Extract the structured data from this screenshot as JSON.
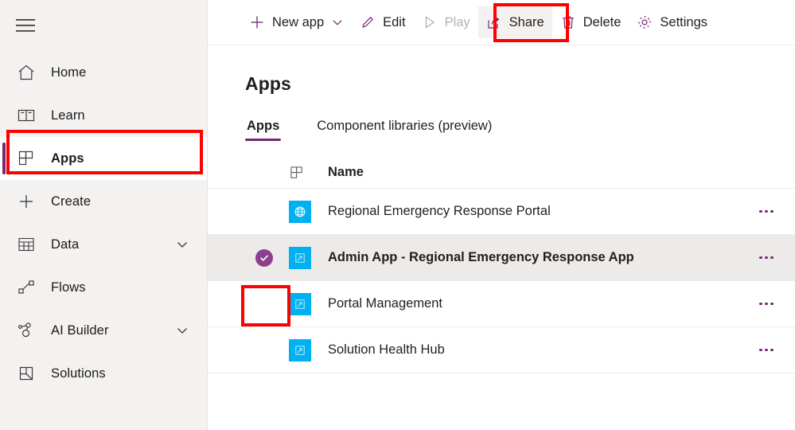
{
  "sidebar": {
    "menu_icon": "hamburger-icon",
    "items": [
      {
        "label": "Home",
        "icon": "home-icon",
        "selected": false,
        "chevron": false
      },
      {
        "label": "Learn",
        "icon": "book-icon",
        "selected": false,
        "chevron": false
      },
      {
        "label": "Apps",
        "icon": "apps-grid-icon",
        "selected": true,
        "chevron": false
      },
      {
        "label": "Create",
        "icon": "plus-icon",
        "selected": false,
        "chevron": false
      },
      {
        "label": "Data",
        "icon": "table-icon",
        "selected": false,
        "chevron": true
      },
      {
        "label": "Flows",
        "icon": "flow-icon",
        "selected": false,
        "chevron": false
      },
      {
        "label": "AI Builder",
        "icon": "ai-builder-icon",
        "selected": false,
        "chevron": true
      },
      {
        "label": "Solutions",
        "icon": "solutions-icon",
        "selected": false,
        "chevron": false
      }
    ]
  },
  "commandbar": {
    "items": [
      {
        "label": "New app",
        "icon": "plus-icon",
        "chevron": true,
        "disabled": false,
        "active": false
      },
      {
        "label": "Edit",
        "icon": "pencil-icon",
        "chevron": false,
        "disabled": false,
        "active": false
      },
      {
        "label": "Play",
        "icon": "play-icon",
        "chevron": false,
        "disabled": true,
        "active": false
      },
      {
        "label": "Share",
        "icon": "share-icon",
        "chevron": false,
        "disabled": false,
        "active": true
      },
      {
        "label": "Delete",
        "icon": "trash-icon",
        "chevron": false,
        "disabled": false,
        "active": false
      },
      {
        "label": "Settings",
        "icon": "gear-icon",
        "chevron": false,
        "disabled": false,
        "active": false
      }
    ]
  },
  "main": {
    "page_title": "Apps",
    "tabs": [
      {
        "label": "Apps",
        "active": true
      },
      {
        "label": "Component libraries (preview)",
        "active": false
      }
    ],
    "table": {
      "header_icon": "apps-grid-icon",
      "header_name": "Name",
      "more_icon": "more-horizontal-icon",
      "rows": [
        {
          "name": "Regional Emergency Response Portal",
          "icon": "globe-icon",
          "selected": false
        },
        {
          "name": "Admin App - Regional Emergency Response App",
          "icon": "model-driven-app-icon",
          "selected": true
        },
        {
          "name": "Portal Management",
          "icon": "model-driven-app-icon",
          "selected": false
        },
        {
          "name": "Solution Health Hub",
          "icon": "model-driven-app-icon",
          "selected": false
        }
      ]
    }
  },
  "annotations": [
    {
      "name": "apps-nav-highlight",
      "color": "#ff0000"
    },
    {
      "name": "share-button-highlight",
      "color": "#ff0000"
    },
    {
      "name": "row-checkbox-highlight",
      "color": "#ff0000"
    }
  ],
  "colors": {
    "accent_purple": "#742774",
    "app_tile_blue": "#00b0f0",
    "sidebar_bg": "#f3f2f1",
    "selected_row_bg": "#edebe9",
    "annotation_red": "#ff0000"
  }
}
